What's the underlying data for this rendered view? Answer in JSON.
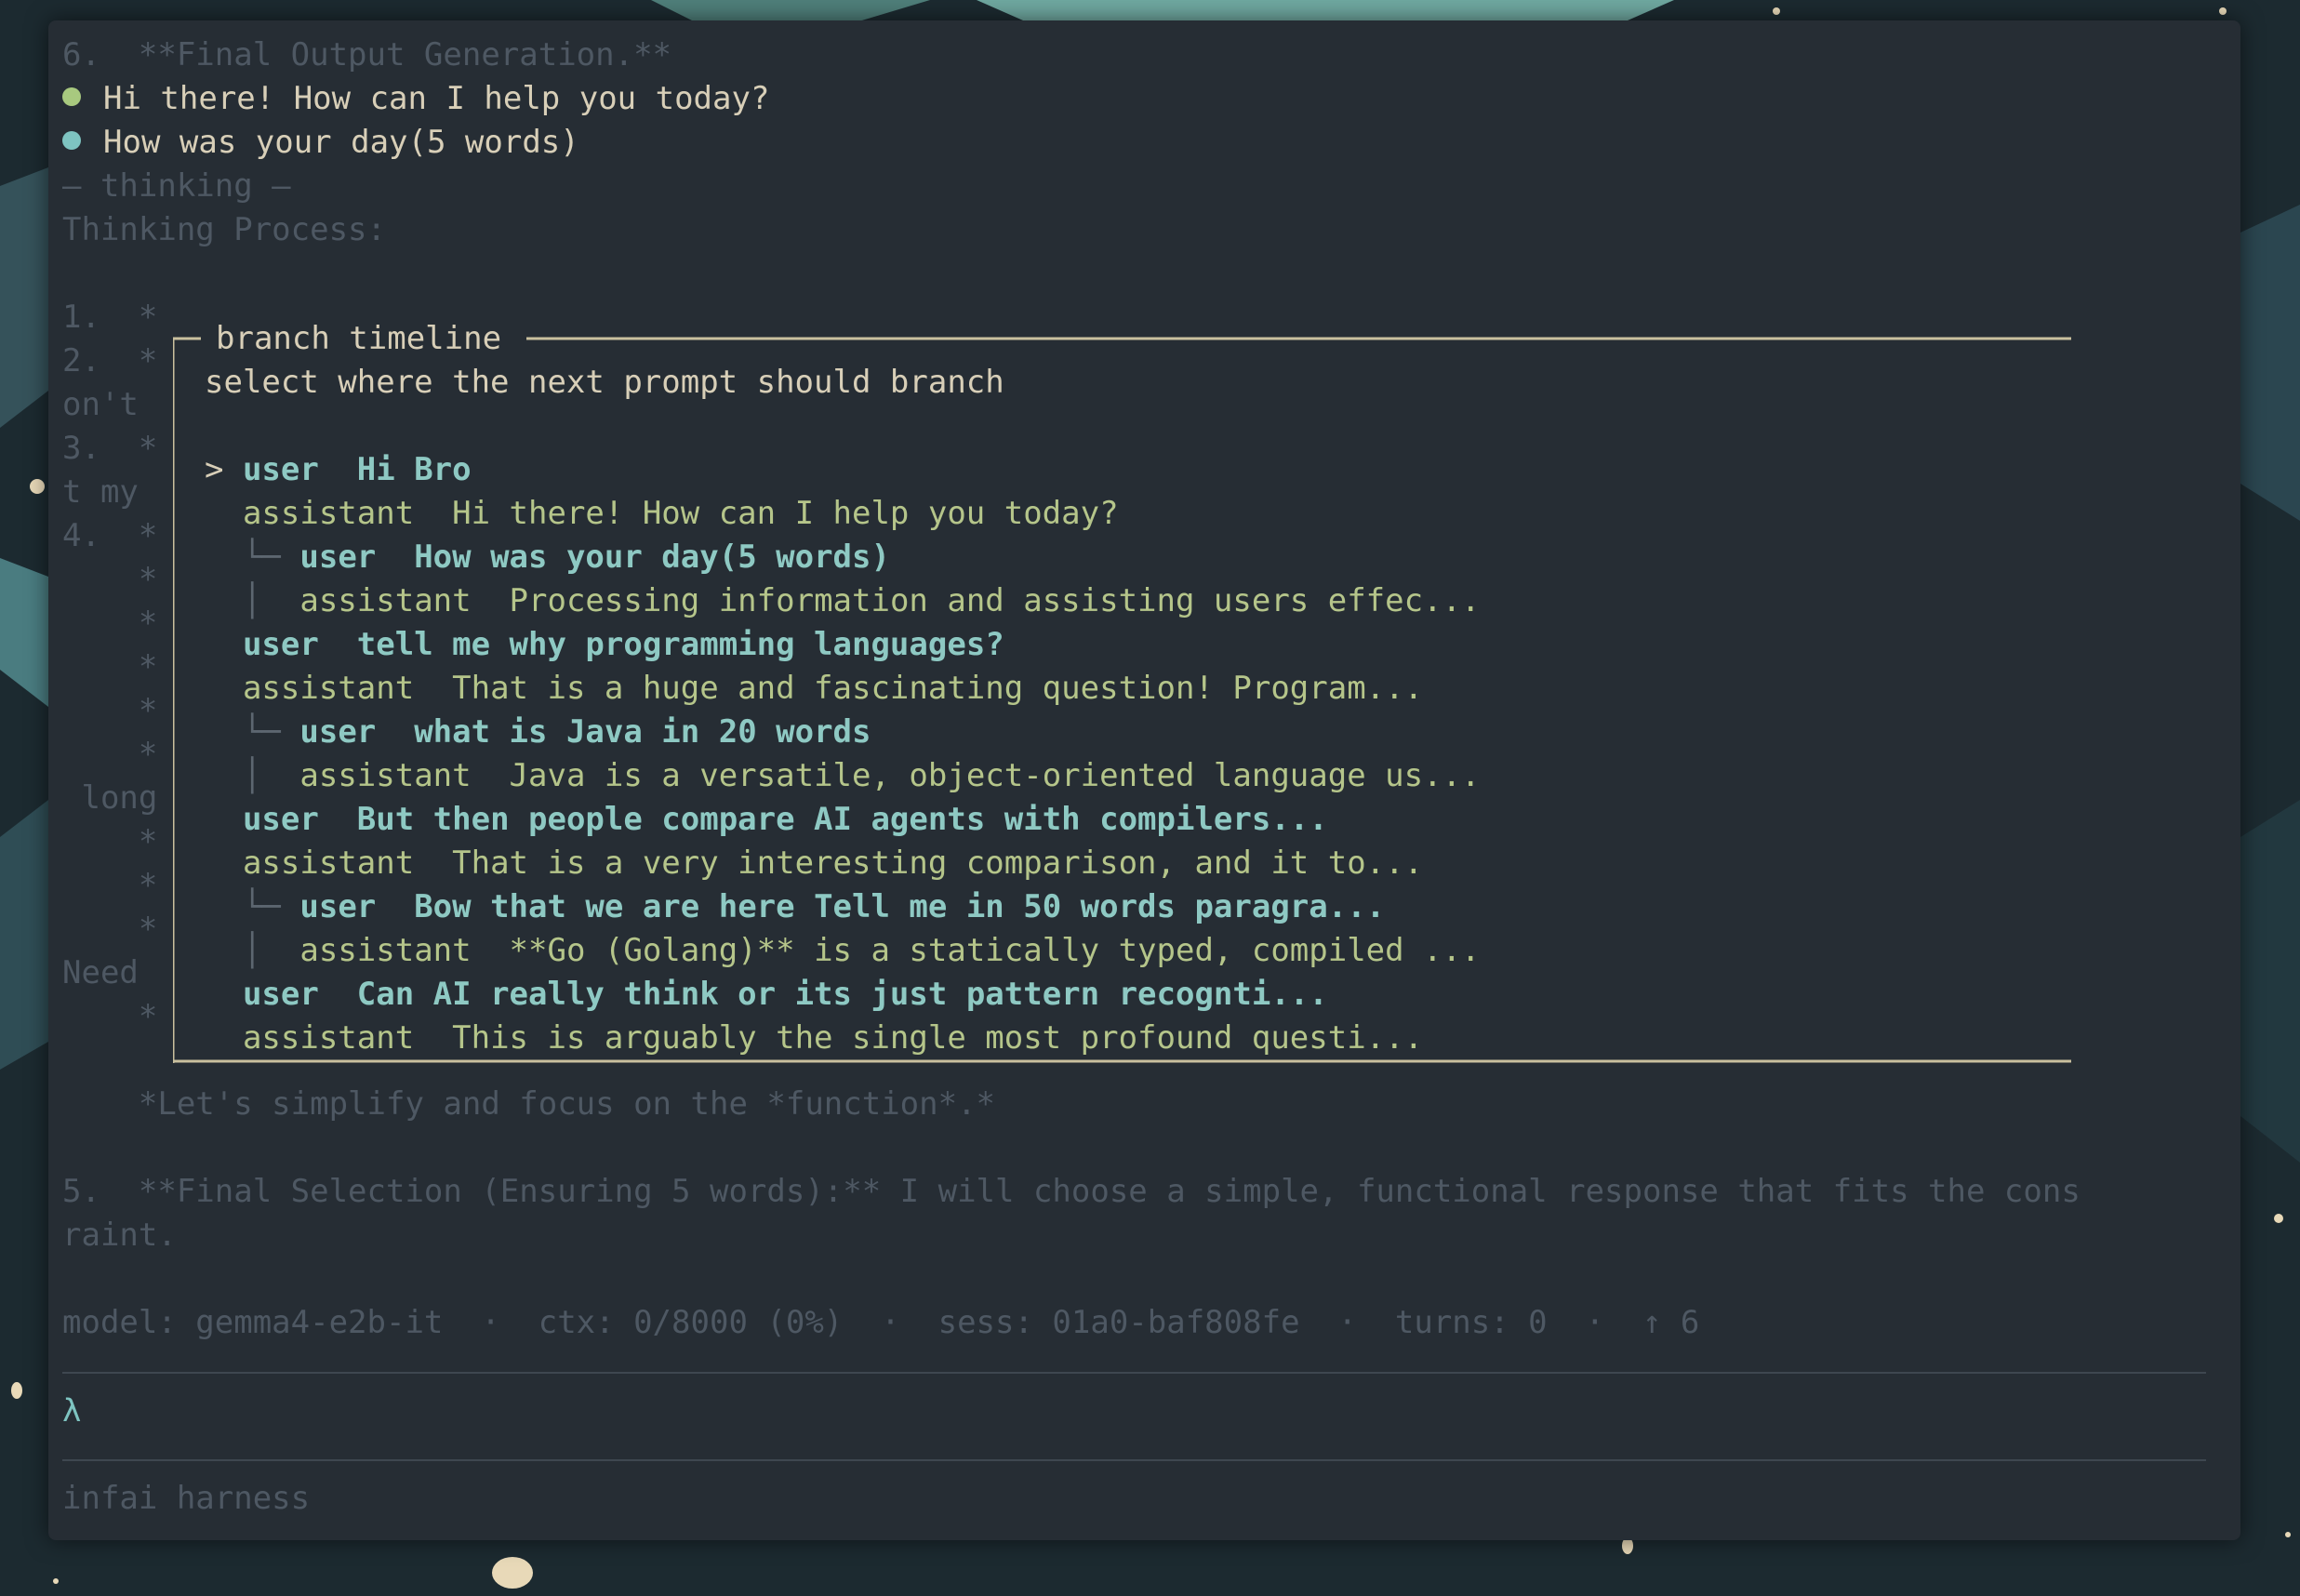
{
  "terminal": {
    "scrollback": [
      "6.  **Final Output Generation.**",
      "Hi there! How can I help you today?",
      "How was your day(5 words)",
      "— thinking —",
      "Thinking Process:"
    ],
    "left_gutter": [
      "1.  *",
      "2.  *",
      "on't",
      "3.  *",
      "t my",
      "4.  *",
      "    *",
      "    *",
      "    *",
      "    *",
      "    *",
      " long",
      "    *",
      "    *",
      "    *",
      "Need",
      "    *"
    ],
    "after_modal": [
      "    *Let's simplify and focus on the *function*.*",
      "5.  **Final Selection (Ensuring 5 words):** I will choose a simple, functional response that fits the cons",
      "raint."
    ],
    "status_line": "model: gemma4-e2b-it  ·  ctx: 0/8000 (0%)  ·  sess: 01a0-baf808fe  ·  turns: 0  ·  ↑ 6",
    "prompt_symbol": "λ",
    "footer": "infai harness"
  },
  "branch_modal": {
    "title": "branch timeline",
    "subtitle": "select where the next prompt should branch",
    "caret": ">",
    "entries": [
      {
        "tree": "",
        "role": "user",
        "text": "Hi Bro"
      },
      {
        "tree": "",
        "role": "assistant",
        "text": "Hi there! How can I help you today?"
      },
      {
        "tree": "└─ ",
        "role": "user",
        "text": "How was your day(5 words)"
      },
      {
        "tree": "│  ",
        "role": "assistant",
        "text": "Processing information and assisting users effec..."
      },
      {
        "tree": "",
        "role": "user",
        "text": "tell me why programming languages?"
      },
      {
        "tree": "",
        "role": "assistant",
        "text": "That is a huge and fascinating question! Program..."
      },
      {
        "tree": "└─ ",
        "role": "user",
        "text": "what is Java in 20 words"
      },
      {
        "tree": "│  ",
        "role": "assistant",
        "text": "Java is a versatile, object-oriented language us..."
      },
      {
        "tree": "",
        "role": "user",
        "text": "But then people compare AI agents with compilers..."
      },
      {
        "tree": "",
        "role": "assistant",
        "text": "That is a very interesting comparison, and it to..."
      },
      {
        "tree": "└─ ",
        "role": "user",
        "text": "Bow that we are here Tell me in 50 words paragra..."
      },
      {
        "tree": "│  ",
        "role": "assistant",
        "text": "**Go (Golang)** is a statically typed, compiled ..."
      },
      {
        "tree": "",
        "role": "user",
        "text": "Can AI really think or its just pattern recognti..."
      },
      {
        "tree": "",
        "role": "assistant",
        "text": "This is arguably the single most profound questi..."
      }
    ]
  },
  "colors": {
    "terminal_bg": "#262d34",
    "dim_text": "#4e5863",
    "bright_text": "#d8cfb8",
    "user_text": "#8ec9c3",
    "assistant_text": "#b5c58a",
    "dot_green": "#a8c97f",
    "dot_cyan": "#7ec4c1"
  }
}
